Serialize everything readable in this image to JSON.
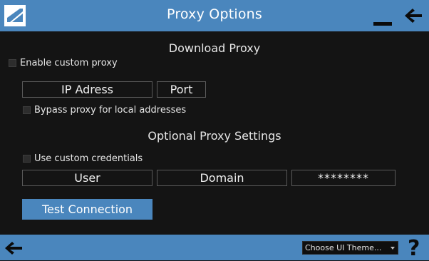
{
  "window": {
    "title": "Proxy Options",
    "accent_color": "#4a86bd",
    "background_color": "#141414",
    "logo_icon": "app-logo-icon",
    "minimize_icon": "minimize-icon",
    "back_icon": "back-arrow-icon"
  },
  "download_proxy": {
    "heading": "Download Proxy",
    "enable_custom_proxy_label": "Enable custom proxy",
    "enable_custom_proxy_checked": false,
    "ip_address_value": "IP Adress",
    "port_value": "Port",
    "bypass_local_label": "Bypass proxy for local addresses",
    "bypass_local_checked": false
  },
  "optional_settings": {
    "heading": "Optional Proxy Settings",
    "use_custom_credentials_label": "Use custom credentials",
    "use_custom_credentials_checked": false,
    "user_value": "User",
    "domain_value": "Domain",
    "password_value": "********"
  },
  "actions": {
    "test_connection_label": "Test Connection"
  },
  "footer": {
    "back_icon": "back-arrow-icon",
    "theme_select_value": "Choose UI Theme...",
    "help_label": "?"
  }
}
